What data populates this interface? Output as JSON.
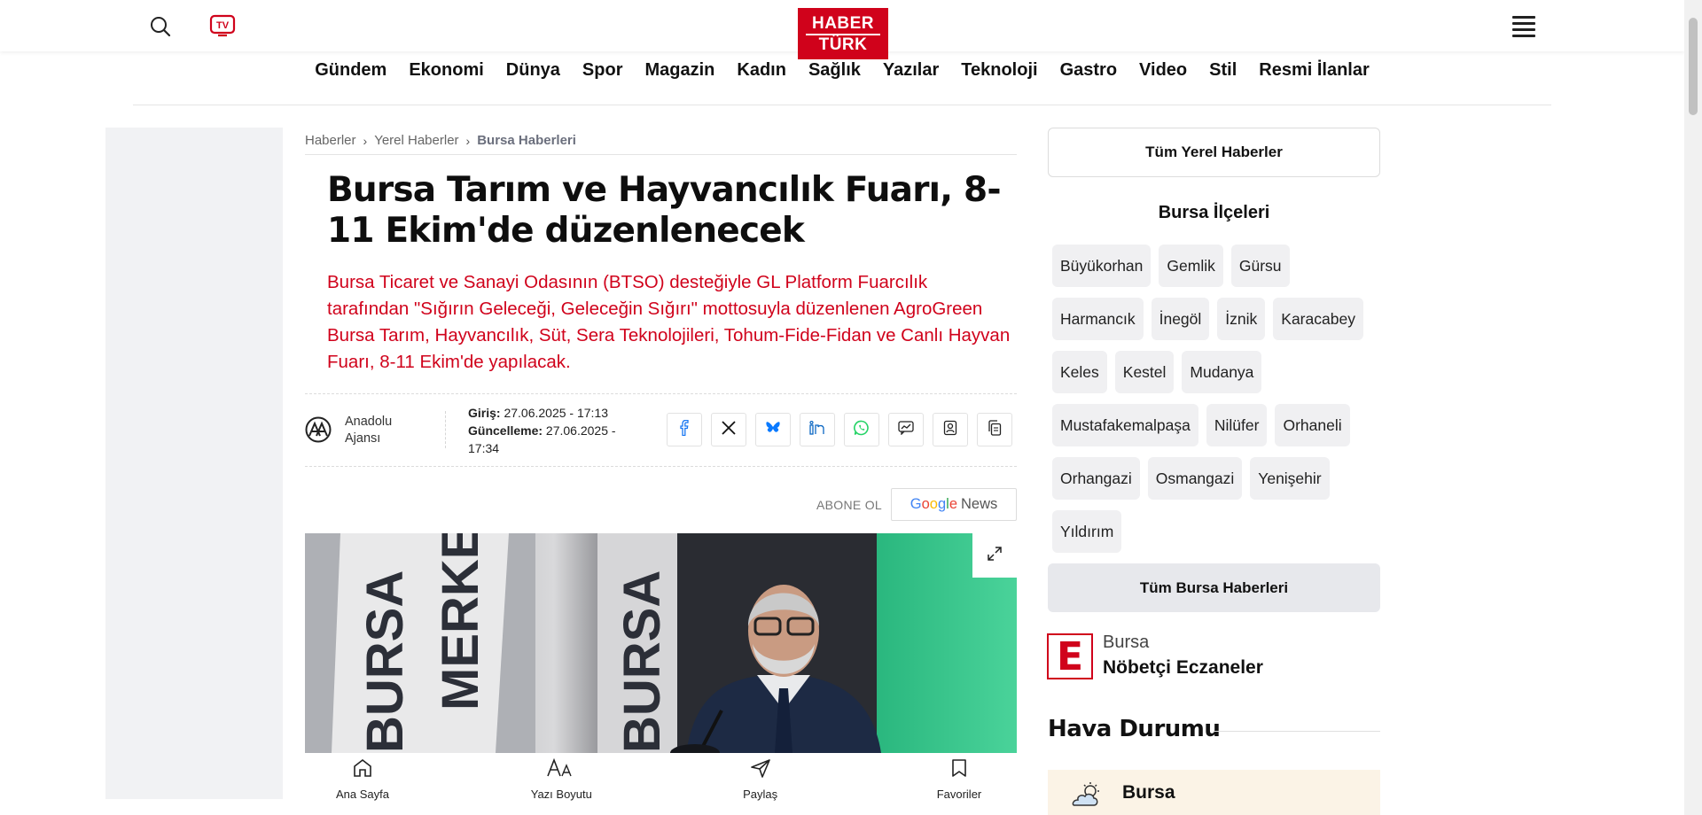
{
  "header": {
    "logo_line1": "HABER",
    "logo_line2": "TÜRK",
    "tv_label": "TV"
  },
  "nav": [
    "Gündem",
    "Ekonomi",
    "Dünya",
    "Spor",
    "Magazin",
    "Kadın",
    "Sağlık",
    "Yazılar",
    "Teknoloji",
    "Gastro",
    "Video",
    "Stil",
    "Resmi İlanlar"
  ],
  "breadcrumb": [
    "Haberler",
    "Yerel Haberler",
    "Bursa Haberleri"
  ],
  "article": {
    "title": "Bursa Tarım ve Hayvancılık Fuarı, 8-11 Ekim'de düzenlenecek",
    "lead": "Bursa Ticaret ve Sanayi Odasının (BTSO) desteğiyle GL Platform Fuarcılık tarafından \"Sığırın Geleceği, Geleceğin Sığırı\" mottosuyla düzenlenen AgroGreen Bursa Tarım, Hayvancılık, Süt, Sera Teknolojileri, Tohum-Fide-Fidan ve Canlı Hayvan Fuarı, 8-11 Ekim'de yapılacak.",
    "source": "Anadolu Ajansı",
    "giris_label": "Giriş:",
    "giris_value": "27.06.2025 - 17:13",
    "guncelleme_label": "Güncelleme:",
    "guncelleme_value": "27.06.2025 - 17:34",
    "share_icons": [
      "facebook-icon",
      "x-icon",
      "bluesky-icon",
      "linkedin-icon",
      "whatsapp-icon",
      "comment-icon",
      "follow-icon",
      "copy-icon"
    ],
    "abone_label": "ABONE OL",
    "gnews": {
      "g1": "G",
      "g2": "o",
      "g3": "o",
      "g4": "g",
      "g5": "l",
      "g6": "e",
      "news": "News"
    },
    "photo_banner_text_1": "BURSA",
    "photo_banner_text_2": "MERKEZİ"
  },
  "bottom_bar": [
    {
      "label": "Ana Sayfa",
      "icon": "home-icon"
    },
    {
      "label": "Yazı Boyutu",
      "icon": "font-size-icon"
    },
    {
      "label": "Paylaş",
      "icon": "share-icon"
    },
    {
      "label": "Favoriler",
      "icon": "bookmark-icon"
    }
  ],
  "sidebar": {
    "all_local": "Tüm Yerel Haberler",
    "districts_title": "Bursa İlçeleri",
    "districts": [
      "Büyükorhan",
      "Gemlik",
      "Gürsu",
      "Harmancık",
      "İnegöl",
      "İznik",
      "Karacabey",
      "Keles",
      "Kestel",
      "Mudanya",
      "Mustafakemalpaşa",
      "Nilüfer",
      "Orhaneli",
      "Orhangazi",
      "Osmangazi",
      "Yenişehir",
      "Yıldırım"
    ],
    "all_bursa": "Tüm Bursa Haberleri",
    "eczane_icon_letter": "E",
    "eczane_city": "Bursa",
    "eczane_title": "Nöbetçi Eczaneler",
    "weather_title": "Hava Durumu",
    "weather_city": "Bursa"
  },
  "colors": {
    "brand_red": "#d0021b"
  }
}
